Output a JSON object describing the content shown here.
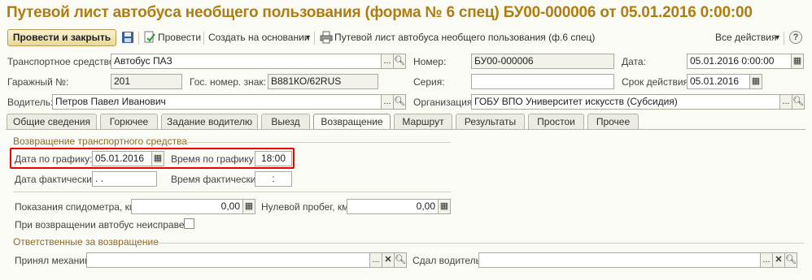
{
  "title": "Путевой лист автобуса необщего пользования (форма № 6 спец) БУ00-000006 от 05.01.2016 0:00:00",
  "toolbar": {
    "post_close": "Провести и закрыть",
    "post": "Провести",
    "create_based": "Создать на основании",
    "print_form": "Путевой лист автобуса необщего пользования (ф.6 спец)",
    "all_actions": "Все действия",
    "help": "?"
  },
  "form": {
    "vehicle_label": "Транспортное средство:",
    "vehicle_value": "Автобус ПАЗ",
    "number_label": "Номер:",
    "number_value": "БУ00-000006",
    "date_label": "Дата:",
    "date_value": "05.01.2016  0:00:00",
    "garage_label": "Гаражный №:",
    "garage_value": "201",
    "gos_label": "Гос. номер. знак:",
    "gos_value": "В881КО/62RUS",
    "series_label": "Серия:",
    "series_value": "",
    "validity_label": "Срок действия:",
    "validity_value": "05.01.2016",
    "driver_label": "Водитель:",
    "driver_value": "Петров Павел Иванович",
    "org_label": "Организация:",
    "org_value": "ГОБУ ВПО Университет искусств (Субсидия)"
  },
  "tabs": [
    "Общие сведения",
    "Горючее",
    "Задание водителю",
    "Выезд",
    "Возвращение",
    "Маршрут",
    "Результаты",
    "Простои",
    "Прочее"
  ],
  "return": {
    "section_title": "Возвращение транспортного средства",
    "sched_date_label": "Дата по графику:",
    "sched_date_value": "05.01.2016",
    "sched_time_label": "Время по графику :",
    "sched_time_value": "18:00",
    "actual_date_label": "Дата фактически:",
    "actual_date_value": " .  .",
    "actual_time_label": "Время фактически:",
    "actual_time_value": ":",
    "speedo_label": "Показания спидометра, км:",
    "speedo_value": "0,00",
    "zero_run_label": "Нулевой пробег, км:",
    "zero_run_value": "0,00",
    "faulty_label": "При возвращении автобус неисправен:",
    "resp_title": "Ответственные за возвращение",
    "mechanic_label": "Принял механик:",
    "mechanic_value": "",
    "handed_label": "Сдал водитель:",
    "handed_value": ""
  }
}
